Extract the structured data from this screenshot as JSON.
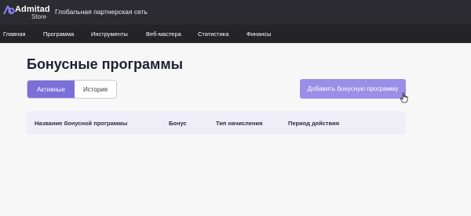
{
  "brand": {
    "name": "Admitad",
    "sub": "Store",
    "tagline": "Глобальная партнерская сеть",
    "accent": "#7b6fd8"
  },
  "nav": {
    "items": [
      {
        "label": "Главная"
      },
      {
        "label": "Программа"
      },
      {
        "label": "Инструменты"
      },
      {
        "label": "Веб-мастера"
      },
      {
        "label": "Статистика"
      },
      {
        "label": "Финансы"
      }
    ]
  },
  "page": {
    "title": "Бонусные программы"
  },
  "tabs": {
    "active": "Активные",
    "history": "История"
  },
  "actions": {
    "add_label": "Добавить бонусную программу"
  },
  "table": {
    "columns": [
      "Название бонусной программы",
      "Бонус",
      "Тип начисления",
      "Период действия"
    ]
  },
  "icons": {
    "logo": "admitad-logo-icon",
    "cursor": "hand-pointer-icon"
  }
}
